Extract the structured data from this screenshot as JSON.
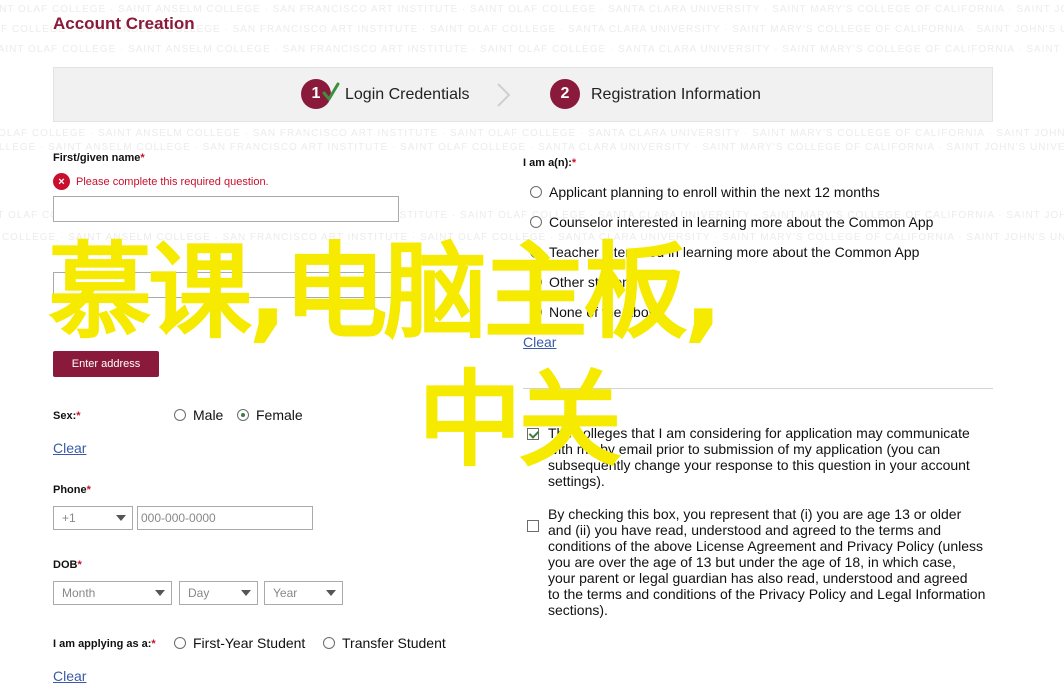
{
  "watermark": {
    "text": "SAINT OLAF COLLEGE · SAINT ANSELM COLLEGE · SAN FRANCISCO ART INSTITUTE · SAINT OLAF COLLEGE · SANTA CLARA UNIVERSITY · SAINT MARY'S COLLEGE OF CALIFORNIA · SAINT JOHN'S UNIVERSITY · SARAH LAWRENCE COLLEGE · SCRIPPS COLLEGE"
  },
  "page": {
    "title": "Account Creation"
  },
  "steps": [
    {
      "number": "1",
      "label": "Login Credentials"
    },
    {
      "number": "2",
      "label": "Registration Information"
    }
  ],
  "colors": {
    "brand": "#8a1a3b",
    "error": "#c8102e",
    "link": "#3b5aa8",
    "overlay": "#f5ea00"
  },
  "icons": {
    "step_complete": "checkmark-icon",
    "step_separator": "chevron-right-icon",
    "error": "error-icon"
  },
  "form": {
    "first_name": {
      "label": "First/given name",
      "required_mark": "*",
      "error": "Please complete this required question.",
      "value": ""
    },
    "address_button": "Enter address",
    "sex": {
      "label": "Sex:",
      "required_mark": "*",
      "options": [
        {
          "label": "Male",
          "selected": false
        },
        {
          "label": "Female",
          "selected": true
        }
      ],
      "clear": "Clear"
    },
    "phone": {
      "label": "Phone",
      "required_mark": "*",
      "country_code": "+1",
      "placeholder": "000-000-0000"
    },
    "dob": {
      "label": "DOB",
      "required_mark": "*",
      "month": "Month",
      "day": "Day",
      "year": "Year"
    },
    "applying_as": {
      "label": "I am applying as a:",
      "required_mark": "*",
      "options": [
        {
          "label": "First-Year Student",
          "selected": false
        },
        {
          "label": "Transfer Student",
          "selected": false
        }
      ],
      "clear": "Clear"
    },
    "i_am_a": {
      "label": "I am a(n):",
      "required_mark": "*",
      "options": [
        {
          "label": "Applicant planning to enroll within the next 12 months",
          "selected": false
        },
        {
          "label": "Counselor interested in learning more about the Common App",
          "selected": false
        },
        {
          "label": "Teacher interested in learning more about the Common App",
          "selected": false
        },
        {
          "label": "Other student",
          "selected": false
        },
        {
          "label": "None of the above",
          "selected": false
        }
      ],
      "clear": "Clear"
    },
    "consent": {
      "checked": true,
      "lines": [
        "The colleges that I am considering for application may communicate",
        "with me by email prior to submission of my application (you can",
        "subsequently change your response to this question in your account",
        "settings)."
      ]
    },
    "terms": {
      "checked": false,
      "lines": [
        "By checking this box, you represent that (i) you are age 13 or older",
        "and (ii) you have read, understood and agreed to the terms and",
        "conditions of the above License Agreement and Privacy Policy (unless",
        "you are over the age of 13 but under the age of 18, in which case,",
        "your parent or legal guardian has also read, understood and agreed",
        "to the terms and conditions of the Privacy Policy and Legal Information",
        "sections)."
      ]
    }
  },
  "overlay": {
    "line1": "慕课,电脑主板,",
    "line2": "中关"
  }
}
